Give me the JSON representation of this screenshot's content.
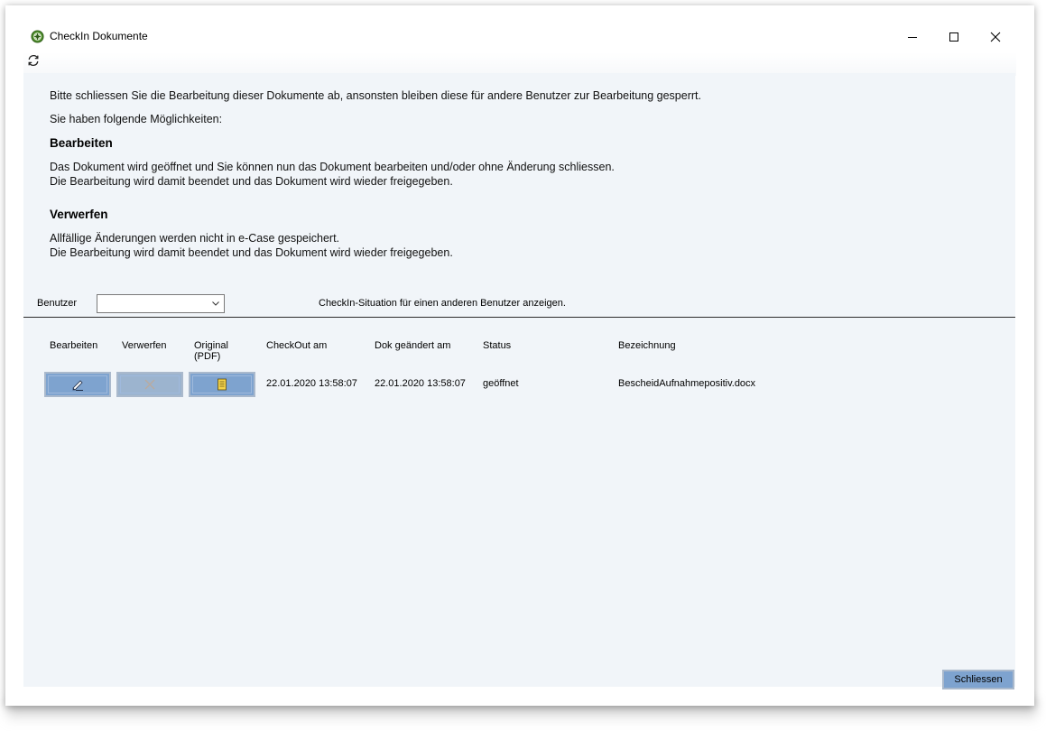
{
  "window": {
    "title": "CheckIn Dokumente"
  },
  "info": {
    "line1": "Bitte schliessen Sie die Bearbeitung dieser Dokumente ab, ansonsten bleiben diese für andere Benutzer zur Bearbeitung gesperrt.",
    "line2": "Sie haben folgende Möglichkeiten:",
    "edit_heading": "Bearbeiten",
    "edit_text1": "Das Dokument wird geöffnet und Sie können nun das Dokument bearbeiten und/oder ohne Änderung schliessen.",
    "edit_text2": "Die Bearbeitung wird damit beendet und das Dokument wird wieder freigegeben.",
    "discard_heading": "Verwerfen",
    "discard_text1": "Allfällige Änderungen werden nicht in e-Case gespeichert.",
    "discard_text2": "Die Bearbeitung wird damit beendet und das Dokument wird wieder freigegeben."
  },
  "filter": {
    "user_label": "Benutzer",
    "user_value": "",
    "hint": "CheckIn-Situation für einen anderen Benutzer anzeigen."
  },
  "table": {
    "headers": {
      "edit": "Bearbeiten",
      "discard": "Verwerfen",
      "original_line1": "Original",
      "original_line2": "(PDF)",
      "checkout": "CheckOut am",
      "changed": "Dok geändert am",
      "status": "Status",
      "name": "Bezeichnung"
    },
    "rows": [
      {
        "checkout": "22.01.2020 13:58:07",
        "changed": "22.01.2020 13:58:07",
        "status": "geöffnet",
        "name": "BescheidAufnahmepositiv.docx"
      }
    ]
  },
  "footer": {
    "close_label": "Schliessen"
  }
}
